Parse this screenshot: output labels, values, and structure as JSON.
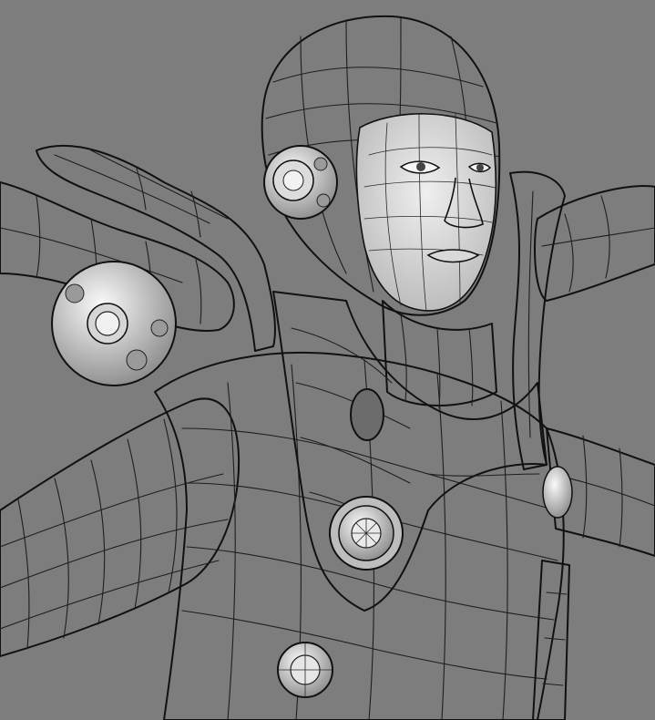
{
  "viewport": {
    "background_color": "#7d7d7d",
    "shade_light": "#f2f2f2",
    "shade_mid": "#cfcfcf",
    "shade_dark": "#8c8c8c",
    "wire_color": "#1e1e1e"
  }
}
